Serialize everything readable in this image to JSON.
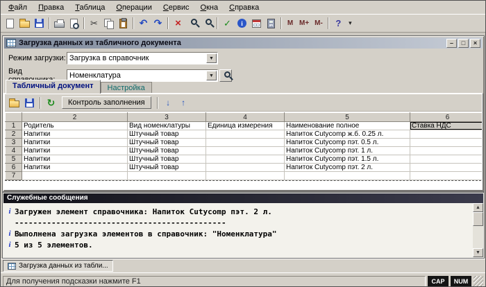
{
  "menu": {
    "items": [
      "Файл",
      "Правка",
      "Таблица",
      "Операции",
      "Сервис",
      "Окна",
      "Справка"
    ]
  },
  "toolbar": {
    "m": [
      "M",
      "M+",
      "M-"
    ]
  },
  "icons": {
    "cut": "✂",
    "undo": "↶",
    "redo": "↷",
    "delete": "×",
    "check": "✓",
    "help": "?",
    "dropdown": "▾",
    "combo_arrow": "▼",
    "refresh": "↻",
    "import": "↓",
    "export": "↑",
    "minimize": "–",
    "maximize": "□",
    "close": "×",
    "up": "▲",
    "down": "▼",
    "info_i": "i",
    "msg_i": "i"
  },
  "dialog": {
    "title": "Загрузка данных из табличного документа",
    "mode_label": "Режим загрузки:",
    "mode_value": "Загрузка в справочник",
    "catalog_label": "Вид справочника:",
    "catalog_value": "Номенклатура",
    "tabs": [
      "Табличный документ",
      "Настройка"
    ],
    "control_button": "Контроль заполнения",
    "table": {
      "cols": [
        "2",
        "3",
        "4",
        "5",
        "6"
      ],
      "rows": [
        {
          "n": "1",
          "cells": [
            "Родитель",
            "Вид номенклатуры",
            "Единица измерения",
            "Наименование полное",
            "Ставка НДС"
          ]
        },
        {
          "n": "2",
          "cells": [
            "Напитки",
            "Штучный товар",
            "",
            "Напиток Cutycomp ж.б. 0.25 л.",
            ""
          ]
        },
        {
          "n": "3",
          "cells": [
            "Напитки",
            "Штучный товар",
            "",
            "Напиток Cutycomp пэт. 0.5 л.",
            ""
          ]
        },
        {
          "n": "4",
          "cells": [
            "Напитки",
            "Штучный товар",
            "",
            "Напиток Cutycomp пэт. 1 л.",
            ""
          ]
        },
        {
          "n": "5",
          "cells": [
            "Напитки",
            "Штучный товар",
            "",
            "Напиток Cutycomp пэт. 1.5 л.",
            ""
          ]
        },
        {
          "n": "6",
          "cells": [
            "Напитки",
            "Штучный товар",
            "",
            "Напиток Cutycomp пэт. 2 л.",
            ""
          ]
        },
        {
          "n": "7",
          "cells": [
            "",
            "",
            "",
            "",
            ""
          ]
        }
      ]
    }
  },
  "messages": {
    "title": "Служебные сообщения",
    "lines": [
      {
        "icon": "info",
        "text": "Загружен элемент справочника: Напиток Cutycomp пэт. 2 л."
      },
      {
        "icon": "",
        "text": "----------------------------------------------"
      },
      {
        "icon": "info",
        "text": "Выполнена загрузка элементов в справочник: \"Номенклатура\""
      },
      {
        "icon": "info",
        "text": "5 из 5 элементов."
      }
    ]
  },
  "taskbar": {
    "button_label": "Загрузка данных из табли..."
  },
  "statusbar": {
    "hint": "Для получения подсказки нажмите F1",
    "caps": "CAP",
    "num": "NUM"
  }
}
